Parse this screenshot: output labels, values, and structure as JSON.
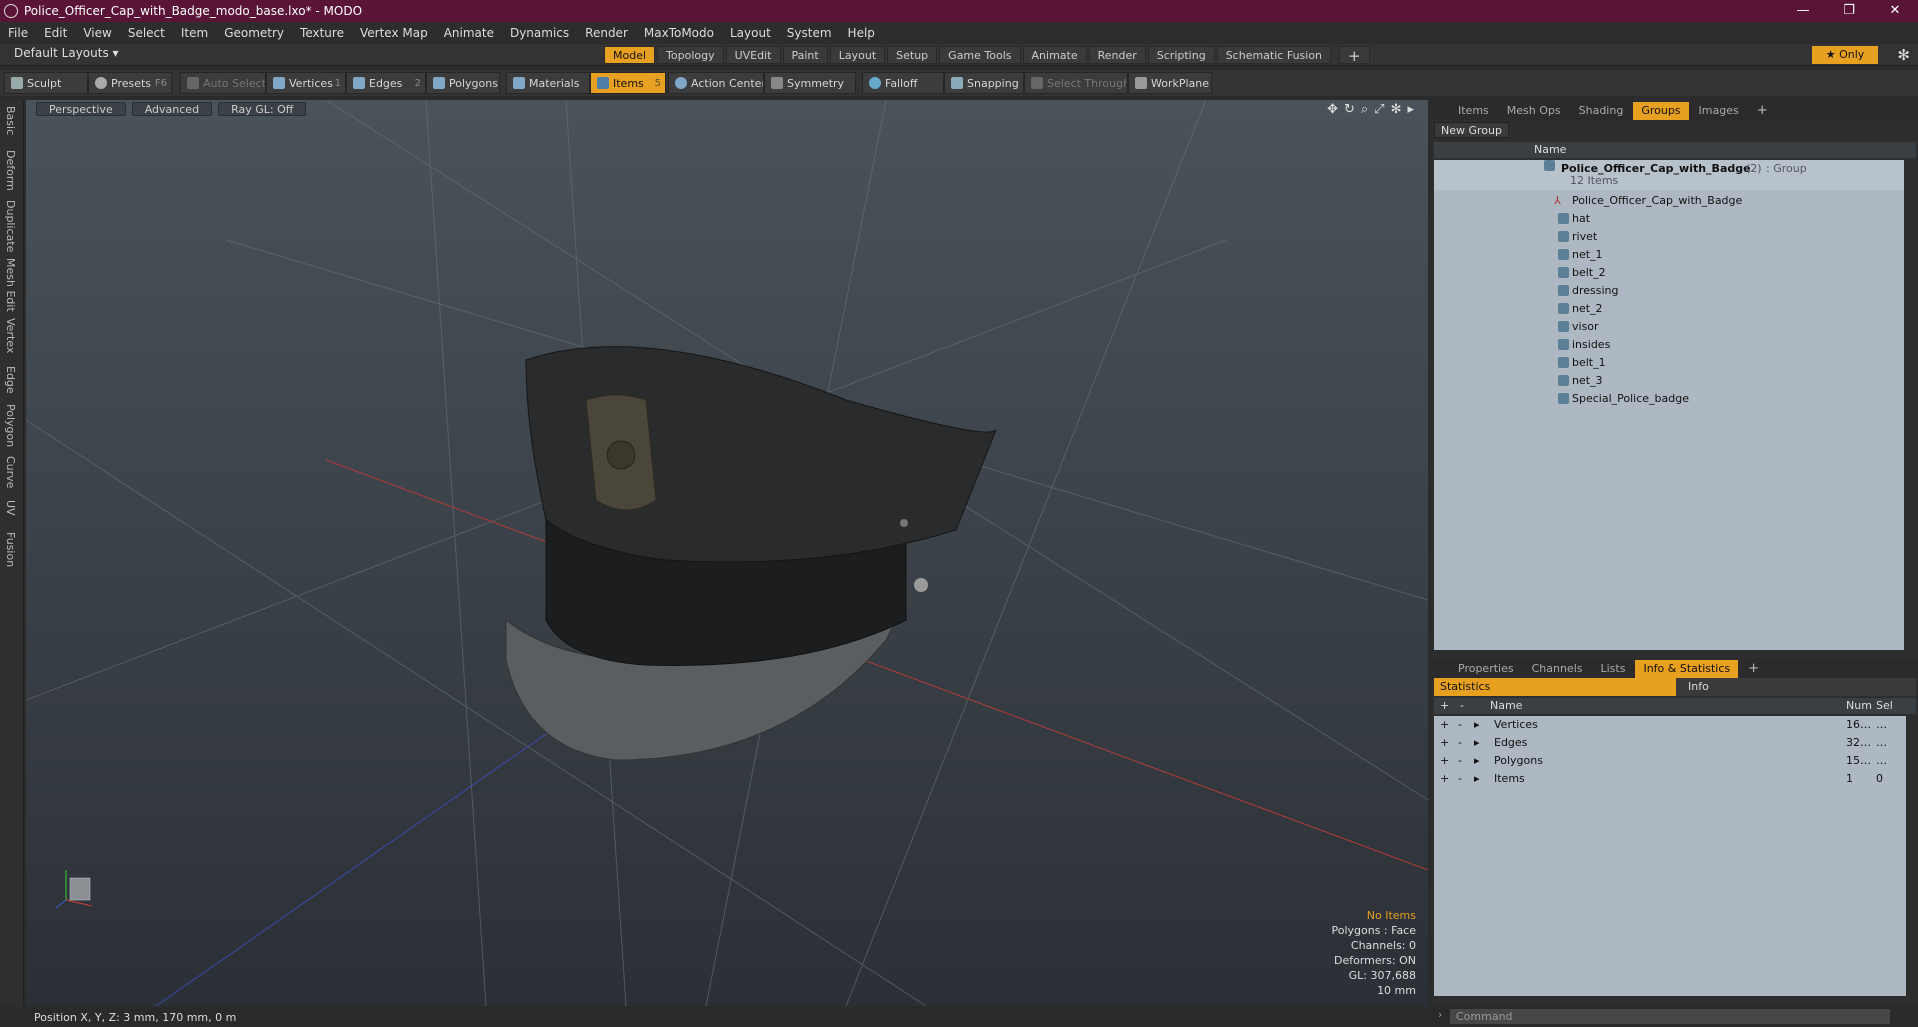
{
  "window": {
    "title": "Police_Officer_Cap_with_Badge_modo_base.lxo* - MODO",
    "controls": [
      "—",
      "❐",
      "✕"
    ]
  },
  "menu": [
    "File",
    "Edit",
    "View",
    "Select",
    "Item",
    "Geometry",
    "Texture",
    "Vertex Map",
    "Animate",
    "Dynamics",
    "Render",
    "MaxToModo",
    "Layout",
    "System",
    "Help"
  ],
  "layout": {
    "selector": "Default Layouts ▾",
    "tabs": [
      "Model",
      "Topology",
      "UVEdit",
      "Paint",
      "Layout",
      "Setup",
      "Game Tools",
      "Animate",
      "Render",
      "Scripting",
      "Schematic Fusion"
    ],
    "active": "Model",
    "plus": "+",
    "only": "★ Only",
    "gear": "✻"
  },
  "toolbar": {
    "sculpt": "Sculpt",
    "presets": "Presets",
    "presets_key": "F6",
    "auto_select": "Auto Select",
    "vertices": "Vertices",
    "vertices_key": "1",
    "edges": "Edges",
    "edges_key": "2",
    "polygons": "Polygons",
    "materials": "Materials",
    "items": "Items",
    "items_key": "5",
    "action_center": "Action Center",
    "symmetry": "Symmetry",
    "falloff": "Falloff",
    "snapping": "Snapping",
    "select_through": "Select Through",
    "workplane": "WorkPlane"
  },
  "lefttabs": [
    "Basic",
    "Deform",
    "Duplicate",
    "Mesh Edit",
    "Vertex",
    "Edge",
    "Polygon",
    "Curve",
    "UV",
    "Fusion"
  ],
  "viewport": {
    "view": "Perspective",
    "shading": "Advanced",
    "raygl": "Ray GL: Off",
    "icons": [
      "✥",
      "↻",
      "⌕",
      "⤢",
      "✻",
      "▸"
    ],
    "stats": {
      "items": "No Items",
      "polygons": "Polygons : Face",
      "channels": "Channels: 0",
      "deformers": "Deformers: ON",
      "gl": "GL: 307,688",
      "scale": "10 mm"
    }
  },
  "status": {
    "position": "Position X, Y, Z:   3 mm, 170 mm, 0 m"
  },
  "panel_tabs_top": [
    "Items",
    "Mesh Ops",
    "Shading",
    "Groups",
    "Images"
  ],
  "panel_tabs_top_active": "Groups",
  "groups": {
    "new_group": "New Group",
    "col_name": "Name",
    "root": {
      "name": "Police_Officer_Cap_with_Badge",
      "count": "(2)",
      "type": ": Group",
      "sub": "12 Items"
    },
    "items": [
      "Police_Officer_Cap_with_Badge",
      "hat",
      "rivet",
      "net_1",
      "belt_2",
      "dressing",
      "net_2",
      "visor",
      "insides",
      "belt_1",
      "net_3",
      "Special_Police_badge"
    ]
  },
  "panel_tabs_bottom": [
    "Properties",
    "Channels",
    "Lists",
    "Info & Statistics"
  ],
  "panel_tabs_bottom_active": "Info & Statistics",
  "stats": {
    "tab_statistics": "Statistics",
    "tab_info": "Info",
    "col_name": "Name",
    "col_num": "Num",
    "col_sel": "Sel",
    "rows": [
      {
        "name": "Vertices",
        "num": "16…",
        "sel": "…"
      },
      {
        "name": "Edges",
        "num": "32…",
        "sel": "…"
      },
      {
        "name": "Polygons",
        "num": "15…",
        "sel": "…"
      },
      {
        "name": "Items",
        "num": "1",
        "sel": "0"
      }
    ]
  },
  "command": {
    "placeholder": "Command"
  }
}
